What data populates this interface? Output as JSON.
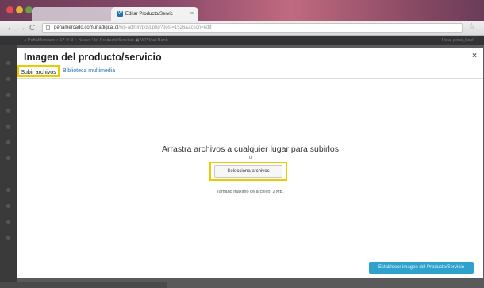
{
  "browser": {
    "tabs": [
      {
        "label": "",
        "active": false
      },
      {
        "label": "Editar Producto/Servic",
        "active": true
      }
    ],
    "url": {
      "host": "penamercado.comunadigital.cl",
      "path": "/wp-admin/post.php?post=1526&action=edit"
    }
  },
  "adminbar": {
    "left_text": "⌂  PeñaMercado   ○ 17   ✉ 3   + Nuevo   Ver Producto/Servicio   ▣ WP Mail Bank",
    "right_text": "Hola, pena_back"
  },
  "modal": {
    "title": "Imagen del producto/servicio",
    "close": "×",
    "tabs": {
      "upload": "Subir archivos",
      "library": "Biblioteca multimedia"
    },
    "drop_instructions": "Arrastra archivos a cualquier lugar para subirlos",
    "or": "o",
    "select_button": "Selecciona archivos",
    "max_size": "Tamaño máximo de archivo: 2 MB.",
    "set_image_button": "Establecer imagen del Producto/Servicio"
  },
  "colors": {
    "highlight": "#e8cc00",
    "link": "#2271b1",
    "primary_button": "#2ea2cc"
  }
}
